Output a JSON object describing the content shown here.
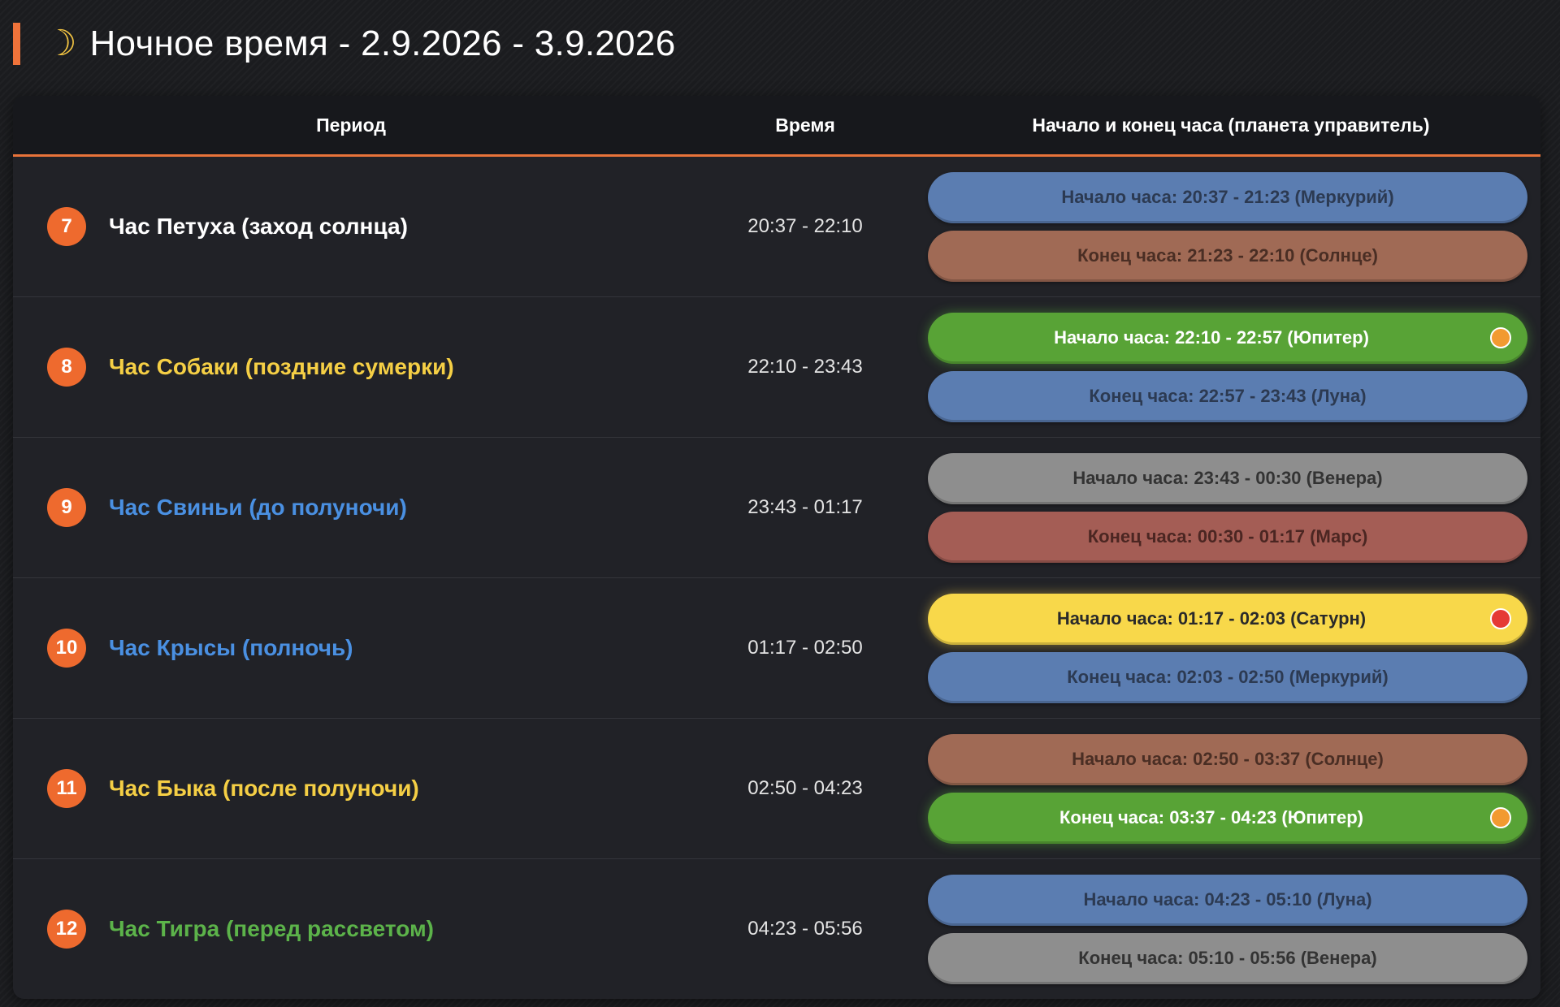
{
  "header": {
    "moon_icon": "crescent-moon-icon",
    "moon_glyph": "☽",
    "title": "Ночное время - 2.9.2026 - 3.9.2026"
  },
  "table": {
    "columns": {
      "period": "Период",
      "time": "Время",
      "hours": "Начало и конец часа (планета управитель)"
    },
    "rows": [
      {
        "num": "7",
        "name": "Час Петуха (заход солнца)",
        "name_color": "#ffffff",
        "time": "20:37 - 22:10",
        "hours": [
          {
            "label": "Начало часа: 20:37 - 21:23 (Меркурий)",
            "bg": "#5b7db1",
            "fg": "#2c3a52",
            "indicator": ""
          },
          {
            "label": "Конец часа: 21:23 - 22:10 (Солнце)",
            "bg": "#a06a55",
            "fg": "#4a2e24",
            "indicator": ""
          }
        ]
      },
      {
        "num": "8",
        "name": "Час Собаки (поздние сумерки)",
        "name_color": "#f5cf45",
        "time": "22:10 - 23:43",
        "hours": [
          {
            "label": "Начало часа: 22:10 - 22:57 (Юпитер)",
            "bg": "#58a336",
            "fg": "#ffffff",
            "indicator": "orange"
          },
          {
            "label": "Конец часа: 22:57 - 23:43 (Луна)",
            "bg": "#5b7db1",
            "fg": "#2c3a52",
            "indicator": ""
          }
        ]
      },
      {
        "num": "9",
        "name": "Час Свиньи (до полуночи)",
        "name_color": "#4a90e2",
        "time": "23:43 - 01:17",
        "hours": [
          {
            "label": "Начало часа: 23:43 - 00:30 (Венера)",
            "bg": "#8e8e8e",
            "fg": "#333333",
            "indicator": ""
          },
          {
            "label": "Конец часа: 00:30 - 01:17 (Марс)",
            "bg": "#a45d55",
            "fg": "#4b2622",
            "indicator": ""
          }
        ]
      },
      {
        "num": "10",
        "name": "Час Крысы (полночь)",
        "name_color": "#4a90e2",
        "time": "01:17 - 02:50",
        "hours": [
          {
            "label": "Начало часа: 01:17 - 02:03 (Сатурн)",
            "bg": "#f8d84a",
            "fg": "#2a2a2a",
            "indicator": "red"
          },
          {
            "label": "Конец часа: 02:03 - 02:50 (Меркурий)",
            "bg": "#5b7db1",
            "fg": "#2c3a52",
            "indicator": ""
          }
        ]
      },
      {
        "num": "11",
        "name": "Час Быка (после полуночи)",
        "name_color": "#f5cf45",
        "time": "02:50 - 04:23",
        "hours": [
          {
            "label": "Начало часа: 02:50 - 03:37 (Солнце)",
            "bg": "#a06a55",
            "fg": "#4a2e24",
            "indicator": ""
          },
          {
            "label": "Конец часа: 03:37 - 04:23 (Юпитер)",
            "bg": "#58a336",
            "fg": "#ffffff",
            "indicator": "orange"
          }
        ]
      },
      {
        "num": "12",
        "name": "Час Тигра (перед рассветом)",
        "name_color": "#5cb34a",
        "time": "04:23 - 05:56",
        "hours": [
          {
            "label": "Начало часа: 04:23 - 05:10 (Луна)",
            "bg": "#5b7db1",
            "fg": "#2c3a52",
            "indicator": ""
          },
          {
            "label": "Конец часа: 05:10 - 05:56 (Венера)",
            "bg": "#8e8e8e",
            "fg": "#333333",
            "indicator": ""
          }
        ]
      }
    ]
  }
}
